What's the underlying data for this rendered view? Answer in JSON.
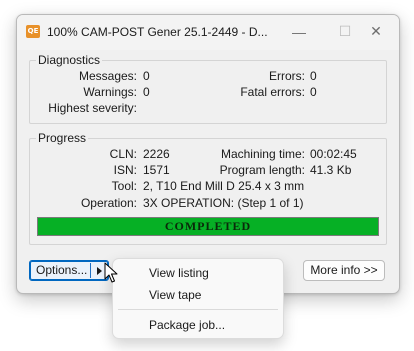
{
  "window": {
    "app_icon_text": "QE",
    "title": "100% CAM-POST Gener 25.1-2449 - D...",
    "minimize_glyph": "—",
    "maximize_glyph": "☐",
    "close_glyph": "✕"
  },
  "diagnostics": {
    "label": "Diagnostics",
    "messages_label": "Messages:",
    "messages_value": "0",
    "warnings_label": "Warnings:",
    "warnings_value": "0",
    "highest_severity_label": "Highest severity:",
    "highest_severity_value": "",
    "errors_label": "Errors:",
    "errors_value": "0",
    "fatal_errors_label": "Fatal errors:",
    "fatal_errors_value": "0"
  },
  "progress": {
    "label": "Progress",
    "cln_label": "CLN:",
    "cln_value": "2226",
    "isn_label": "ISN:",
    "isn_value": "1571",
    "tool_label": "Tool:",
    "tool_value": "2, T10 End Mill D 25.4 x 3 mm",
    "operation_label": "Operation:",
    "operation_value": "3X OPERATION: (Step 1 of 1)",
    "machining_time_label": "Machining time:",
    "machining_time_value": "00:02:45",
    "program_length_label": "Program length:",
    "program_length_value": "41.3 Kb",
    "bar_text": "COMPLETED",
    "bar_fraction": 1.0,
    "bar_color": "#06b025"
  },
  "buttons": {
    "options_label": "Options...",
    "more_info_label": "More info >>"
  },
  "menu": {
    "items": [
      {
        "label": "View listing"
      },
      {
        "label": "View tape"
      },
      {
        "label": "Package job..."
      }
    ]
  },
  "icons": {
    "split_arrow": "triangle-right-icon",
    "cursor": "mouse-pointer-icon"
  }
}
